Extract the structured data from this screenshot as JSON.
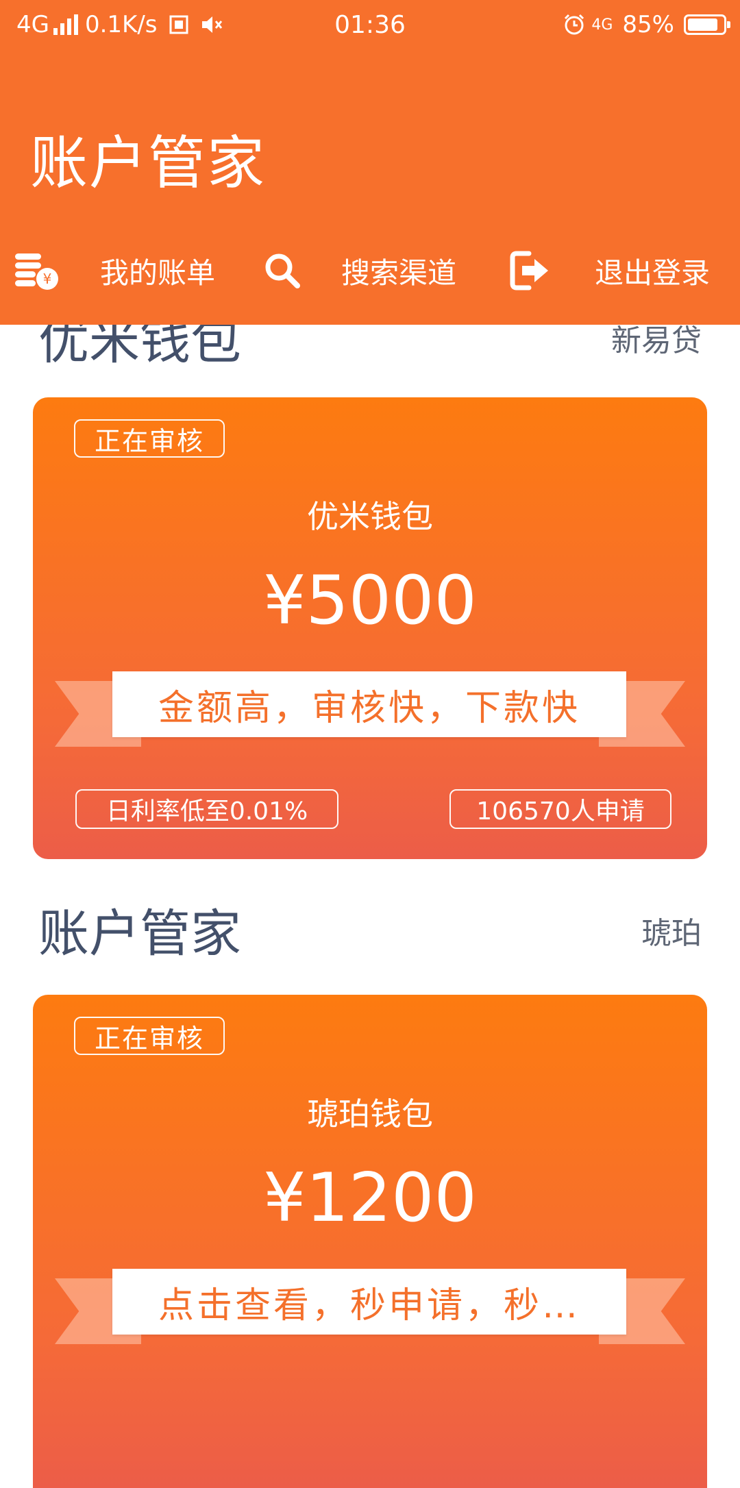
{
  "status_bar": {
    "network": "4G",
    "speed": "0.1K/s",
    "time": "01:36",
    "network_right": "4G",
    "battery": "85%",
    "battery_level": 0.85
  },
  "header": {
    "title": "账户管家",
    "nav": [
      {
        "label": "我的账单",
        "icon": "coins-icon"
      },
      {
        "label": "搜索渠道",
        "icon": "search-icon"
      },
      {
        "label": "退出登录",
        "icon": "logout-icon"
      }
    ]
  },
  "colors": {
    "header_bg": "#f7702c",
    "card_top": "#fd7b10",
    "card_bottom": "#ec5d48",
    "title_text": "#43506a"
  },
  "sections": [
    {
      "title": "优米钱包",
      "tag": "新易贷",
      "card": {
        "status": "正在审核",
        "name": "优米钱包",
        "amount": "¥5000",
        "slogan": "金额高，审核快，下款快",
        "rate": "日利率低至0.01%",
        "applicants": "106570人申请"
      }
    },
    {
      "title": "账户管家",
      "tag": "琥珀",
      "card": {
        "status": "正在审核",
        "name": "琥珀钱包",
        "amount": "¥1200",
        "slogan": "点击查看，秒申请，秒…"
      }
    }
  ]
}
